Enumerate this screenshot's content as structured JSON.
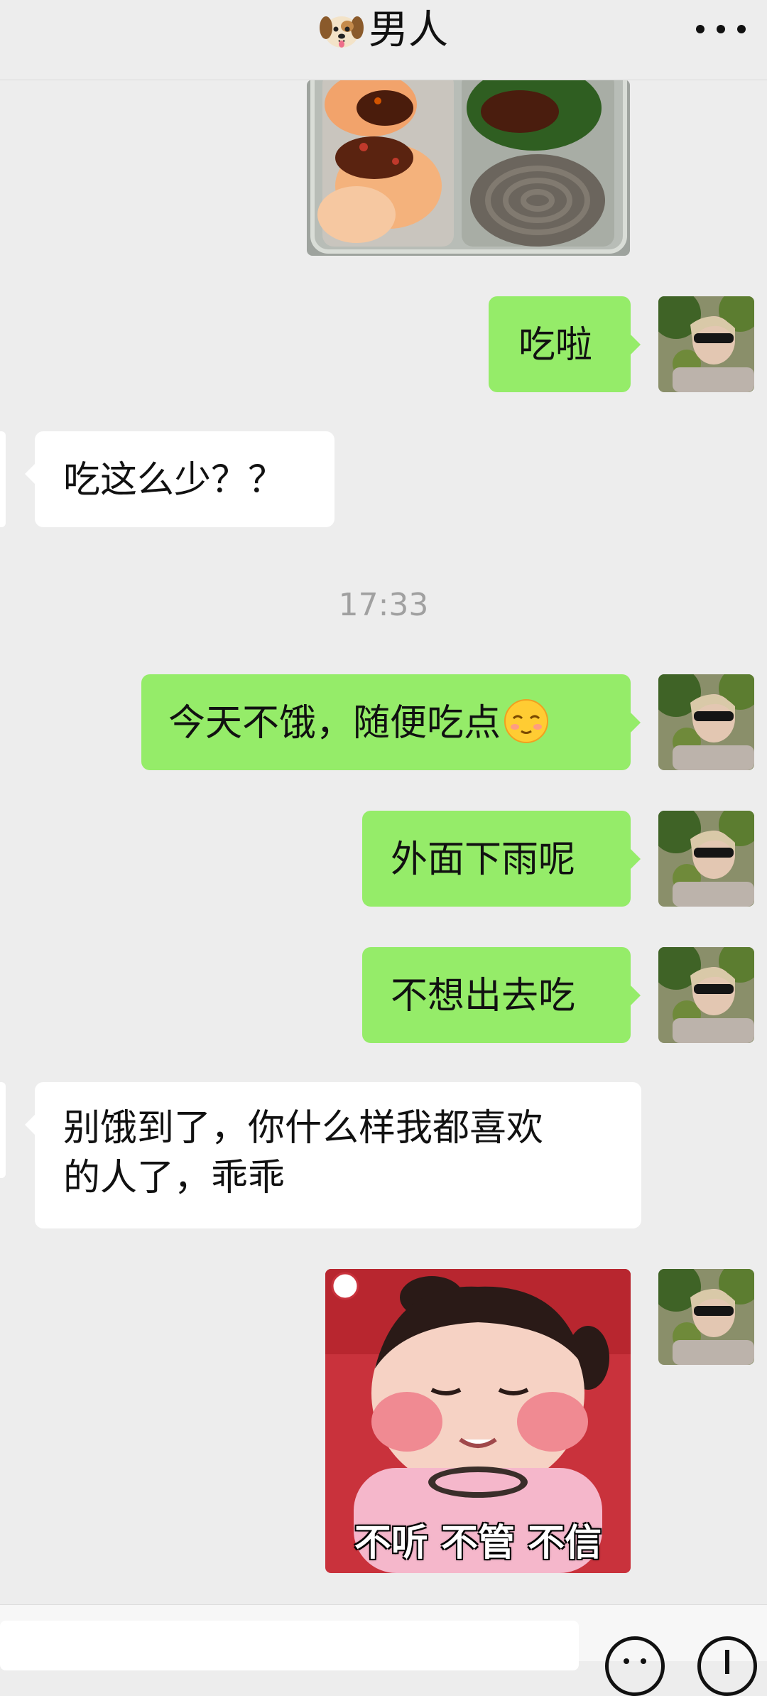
{
  "header": {
    "title": "男人",
    "dog_icon": "dog-face-icon",
    "more_icon": "more-dots-icon"
  },
  "messages": [
    {
      "type": "image",
      "from": "me",
      "alt_icon": "shrimp-noodle-meal-photo"
    },
    {
      "type": "text",
      "from": "me",
      "text": "吃啦"
    },
    {
      "type": "text",
      "from": "other",
      "text": "吃这么少？？"
    },
    {
      "type": "time",
      "text": "17:33"
    },
    {
      "type": "text",
      "from": "me",
      "text": "今天不饿，随便吃点",
      "emoji": "relieved-face-emoji"
    },
    {
      "type": "text",
      "from": "me",
      "text": "外面下雨呢"
    },
    {
      "type": "text",
      "from": "me",
      "text": "不想出去吃"
    },
    {
      "type": "text",
      "from": "other",
      "lines": [
        "别饿到了，你什么样我都喜欢",
        "的人了，乖乖"
      ]
    },
    {
      "type": "sticker",
      "from": "me",
      "caption": "不听 不管 不信"
    }
  ],
  "colors": {
    "my_bubble": "#95ec69",
    "other_bubble": "#ffffff",
    "background": "#ededed",
    "timestamp": "#a0a0a0"
  },
  "input_bar": {
    "emoji_icon": "emoji-smile-icon",
    "plus_icon": "plus-circle-icon"
  }
}
